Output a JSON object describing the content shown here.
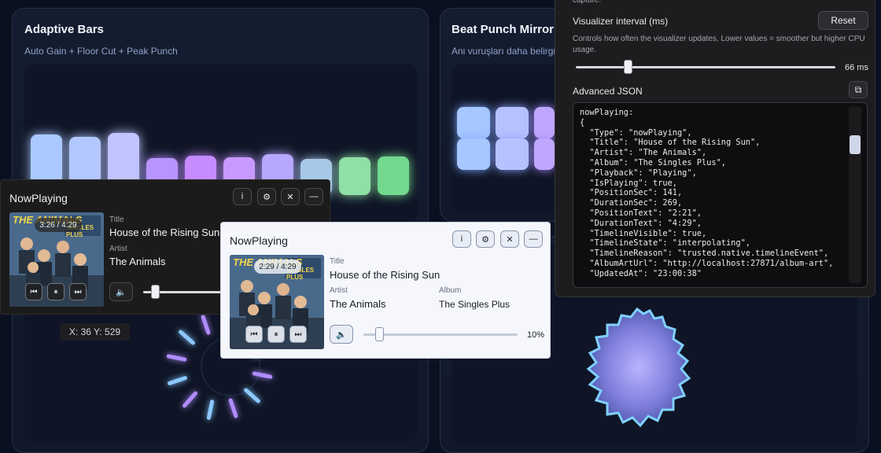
{
  "cards": {
    "adaptive": {
      "title": "Adaptive Bars",
      "subtitle": "Auto Gain + Floor Cut + Peak Punch"
    },
    "beat": {
      "title": "Beat Punch Mirror",
      "subtitle": "Ani vuruşları daha belirgi"
    }
  },
  "bars": {
    "levels": [
      0.85,
      0.82,
      0.88,
      0.52,
      0.55,
      0.53,
      0.58,
      0.51,
      0.53,
      0.54
    ],
    "colors": [
      "#a9c9ff",
      "#b3c7ff",
      "#c0c4ff",
      "#b894ff",
      "#c58bff",
      "#c899ff",
      "#b7a7ff",
      "#a8c8e8",
      "#8fe0a6",
      "#72d98e"
    ]
  },
  "settings": {
    "top_cut_text": "capture.",
    "interval_label": "Visualizer interval (ms)",
    "reset_label": "Reset",
    "interval_help": "Controls how often the visualizer updates. Lower values = smoother but higher CPU usage.",
    "interval_value": "66 ms",
    "interval_fraction": 0.2,
    "advanced_label": "Advanced JSON",
    "json_text": "nowPlaying:\n{\n  \"Type\": \"nowPlaying\",\n  \"Title\": \"House of the Rising Sun\",\n  \"Artist\": \"The Animals\",\n  \"Album\": \"The Singles Plus\",\n  \"Playback\": \"Playing\",\n  \"IsPlaying\": true,\n  \"PositionSec\": 141,\n  \"DurationSec\": 269,\n  \"PositionText\": \"2:21\",\n  \"DurationText\": \"4:29\",\n  \"TimelineVisible\": true,\n  \"TimelineState\": \"interpolating\",\n  \"TimelineReason\": \"trusted.native.timelineEvent\",\n  \"AlbumArtUrl\": \"http://localhost:27871/album-art\",\n  \"UpdatedAt\": \"23:00:38\""
  },
  "np_dark": {
    "title": "NowPlaying",
    "time": "3:26 / 4:29",
    "title_label": "Title",
    "title_value": "House of the Rising Sun",
    "artist_label": "Artist",
    "artist_value": "The Animals",
    "volume_fraction": 0.15
  },
  "np_light": {
    "title": "NowPlaying",
    "time": "2:29 / 4:29",
    "title_label": "Title",
    "title_value": "House of the Rising Sun",
    "artist_label": "Artist",
    "artist_value": "The Animals",
    "album_label": "Album",
    "album_value": "The Singles Plus",
    "volume_value": "10%",
    "volume_fraction": 0.1
  },
  "album_art": {
    "band": "THE ANIMALS",
    "banner_text": "THE SINGLES PLUS"
  },
  "icons": {
    "info": "i",
    "settings": "⚙",
    "unpin": "✕",
    "minimize": "—",
    "prev": "⏮",
    "pause": "⏸",
    "next": "⏭",
    "volume": "🔈",
    "copy": "⧉"
  },
  "coord_readout": "X: 36 Y: 529"
}
